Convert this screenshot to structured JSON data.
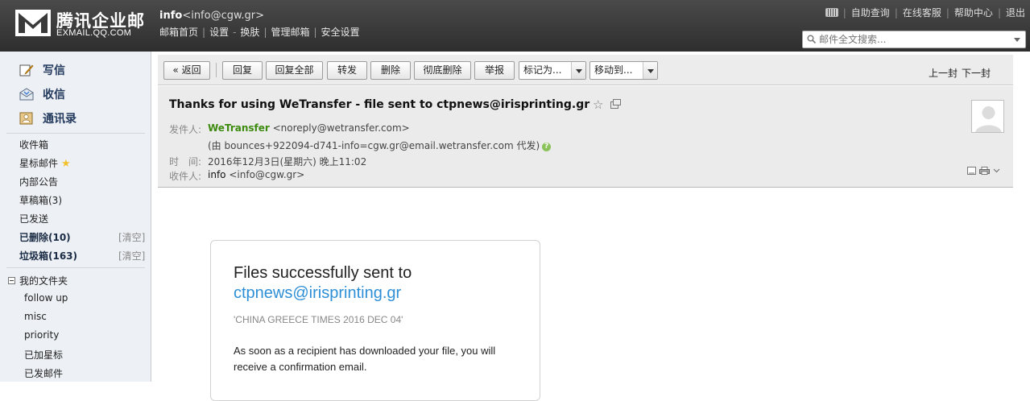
{
  "app": {
    "logo_cn": "腾讯企业邮",
    "logo_en": "EXMAIL.QQ.COM"
  },
  "account": {
    "name": "info",
    "email": "<info@cgw.gr>",
    "nav": [
      "邮箱首页",
      "设置",
      "换肤",
      "管理邮箱",
      "安全设置"
    ]
  },
  "toplinks": [
    "自助查询",
    "在线客服",
    "帮助中心",
    "退出"
  ],
  "search": {
    "placeholder": "邮件全文搜索..."
  },
  "sidebar": {
    "primary": [
      "写信",
      "收信",
      "通讯录"
    ],
    "folders": {
      "inbox": "收件箱",
      "starred": "星标邮件",
      "notice": "内部公告",
      "drafts": "草稿箱(3)",
      "sent": "已发送",
      "deleted": "已删除(10)",
      "spam": "垃圾箱(163)",
      "clear": "[清空]"
    },
    "my_folders_label": "我的文件夹",
    "my_folders": [
      "follow up",
      "misc",
      "priority",
      "已加星标",
      "已发邮件"
    ]
  },
  "toolbar": {
    "back": "« 返回",
    "reply": "回复",
    "reply_all": "回复全部",
    "forward": "转发",
    "delete": "删除",
    "delete_perm": "彻底删除",
    "report": "举报",
    "mark_as": "标记为...",
    "move_to": "移动到...",
    "prev": "上一封",
    "next": "下一封"
  },
  "email": {
    "subject": "Thanks for using WeTransfer - file sent to ctpnews@irisprinting.gr",
    "from_label": "发件人:",
    "from_name": "WeTransfer",
    "from_addr": "<noreply@wetransfer.com>",
    "via": "(由 bounces+922094-d741-info=cgw.gr@email.wetransfer.com 代发)",
    "time_label": "时　间:",
    "time": "2016年12月3日(星期六) 晚上11:02",
    "to_label": "收件人:",
    "to_name": "info",
    "to_addr": "<info@cgw.gr>"
  },
  "card": {
    "title": "Files successfully sent to",
    "email": "ctpnews@irisprinting.gr",
    "message": "'CHINA GREECE TIMES 2016 DEC 04'",
    "text": "As soon as a recipient has downloaded your file, you will receive a confirmation email."
  },
  "colors": {
    "topbar": "#3a3a3a",
    "sidebar": "#edf0f4",
    "sender": "#3d8b0e",
    "link": "#2e8fd6"
  }
}
